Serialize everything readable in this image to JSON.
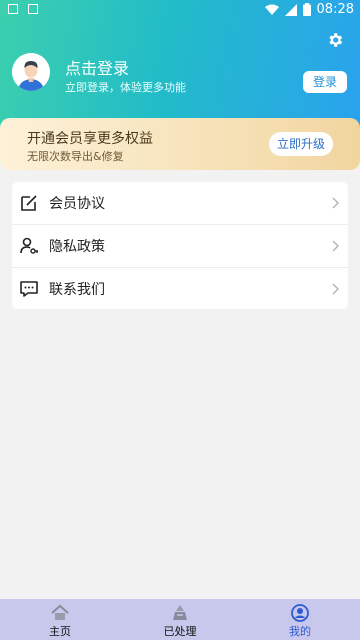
{
  "status_bar": {
    "time": "08:28"
  },
  "profile": {
    "title": "点击登录",
    "subtitle": "立即登录，体验更多功能",
    "login_button": "登录"
  },
  "vip": {
    "title": "开通会员享更多权益",
    "subtitle": "无限次数导出&修复",
    "button": "立即升级"
  },
  "menu": {
    "items": [
      {
        "label": "会员协议",
        "icon": "edit-icon"
      },
      {
        "label": "隐私政策",
        "icon": "user-key-icon"
      },
      {
        "label": "联系我们",
        "icon": "message-icon"
      }
    ]
  },
  "tabbar": {
    "items": [
      {
        "label": "主页",
        "icon": "home-icon",
        "active": false
      },
      {
        "label": "已处理",
        "icon": "processed-icon",
        "active": false
      },
      {
        "label": "我的",
        "icon": "user-icon",
        "active": true
      }
    ],
    "active_color": "#2f5ad1"
  }
}
